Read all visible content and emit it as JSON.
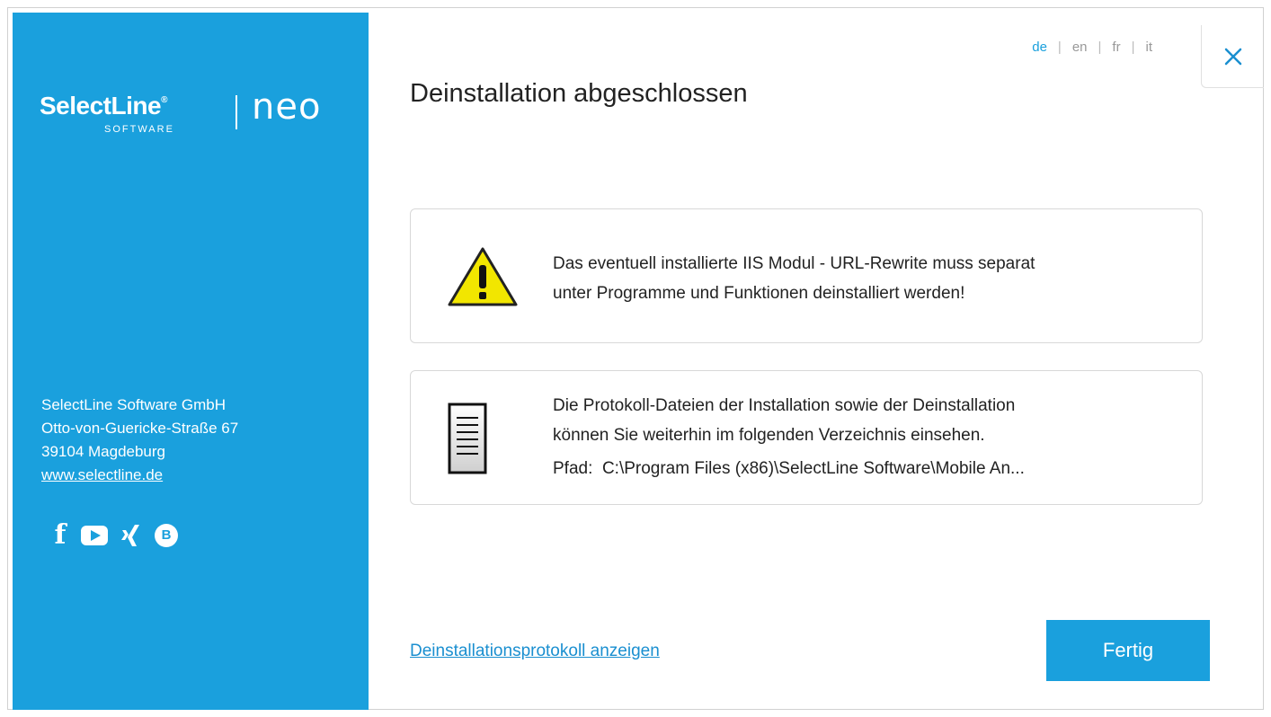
{
  "sidebar": {
    "logo": {
      "brand": "SelectLine",
      "registered": "®",
      "sub": "SOFTWARE",
      "product": "neo"
    },
    "address": {
      "company": "SelectLine Software GmbH",
      "street": "Otto-von-Guericke-Straße 67",
      "city": "39104 Magdeburg",
      "website": "www.selectline.de"
    },
    "social": {
      "facebook_icon": "f",
      "youtube_icon": "youtube-icon",
      "xing_icon": "✗",
      "blog_icon": "B"
    }
  },
  "header": {
    "languages": [
      "de",
      "en",
      "fr",
      "it"
    ],
    "active_language": "de",
    "separator": "|",
    "close_icon": "close-icon"
  },
  "main": {
    "title": "Deinstallation abgeschlossen",
    "warning": {
      "line1": "Das eventuell installierte IIS Modul - URL-Rewrite muss separat",
      "line2": "unter Programme und Funktionen deinstalliert werden!"
    },
    "logs": {
      "line1": "Die Protokoll-Dateien der Installation sowie der Deinstallation",
      "line2": "können Sie weiterhin im folgenden Verzeichnis einsehen.",
      "path_label": "Pfad:",
      "path_value": "C:\\Program Files (x86)\\SelectLine Software\\Mobile An..."
    },
    "show_log_link": "Deinstallationsprotokoll anzeigen",
    "finish_button": "Fertig"
  },
  "colors": {
    "accent": "#1aa0dd",
    "warning_yellow": "#f2e600"
  }
}
